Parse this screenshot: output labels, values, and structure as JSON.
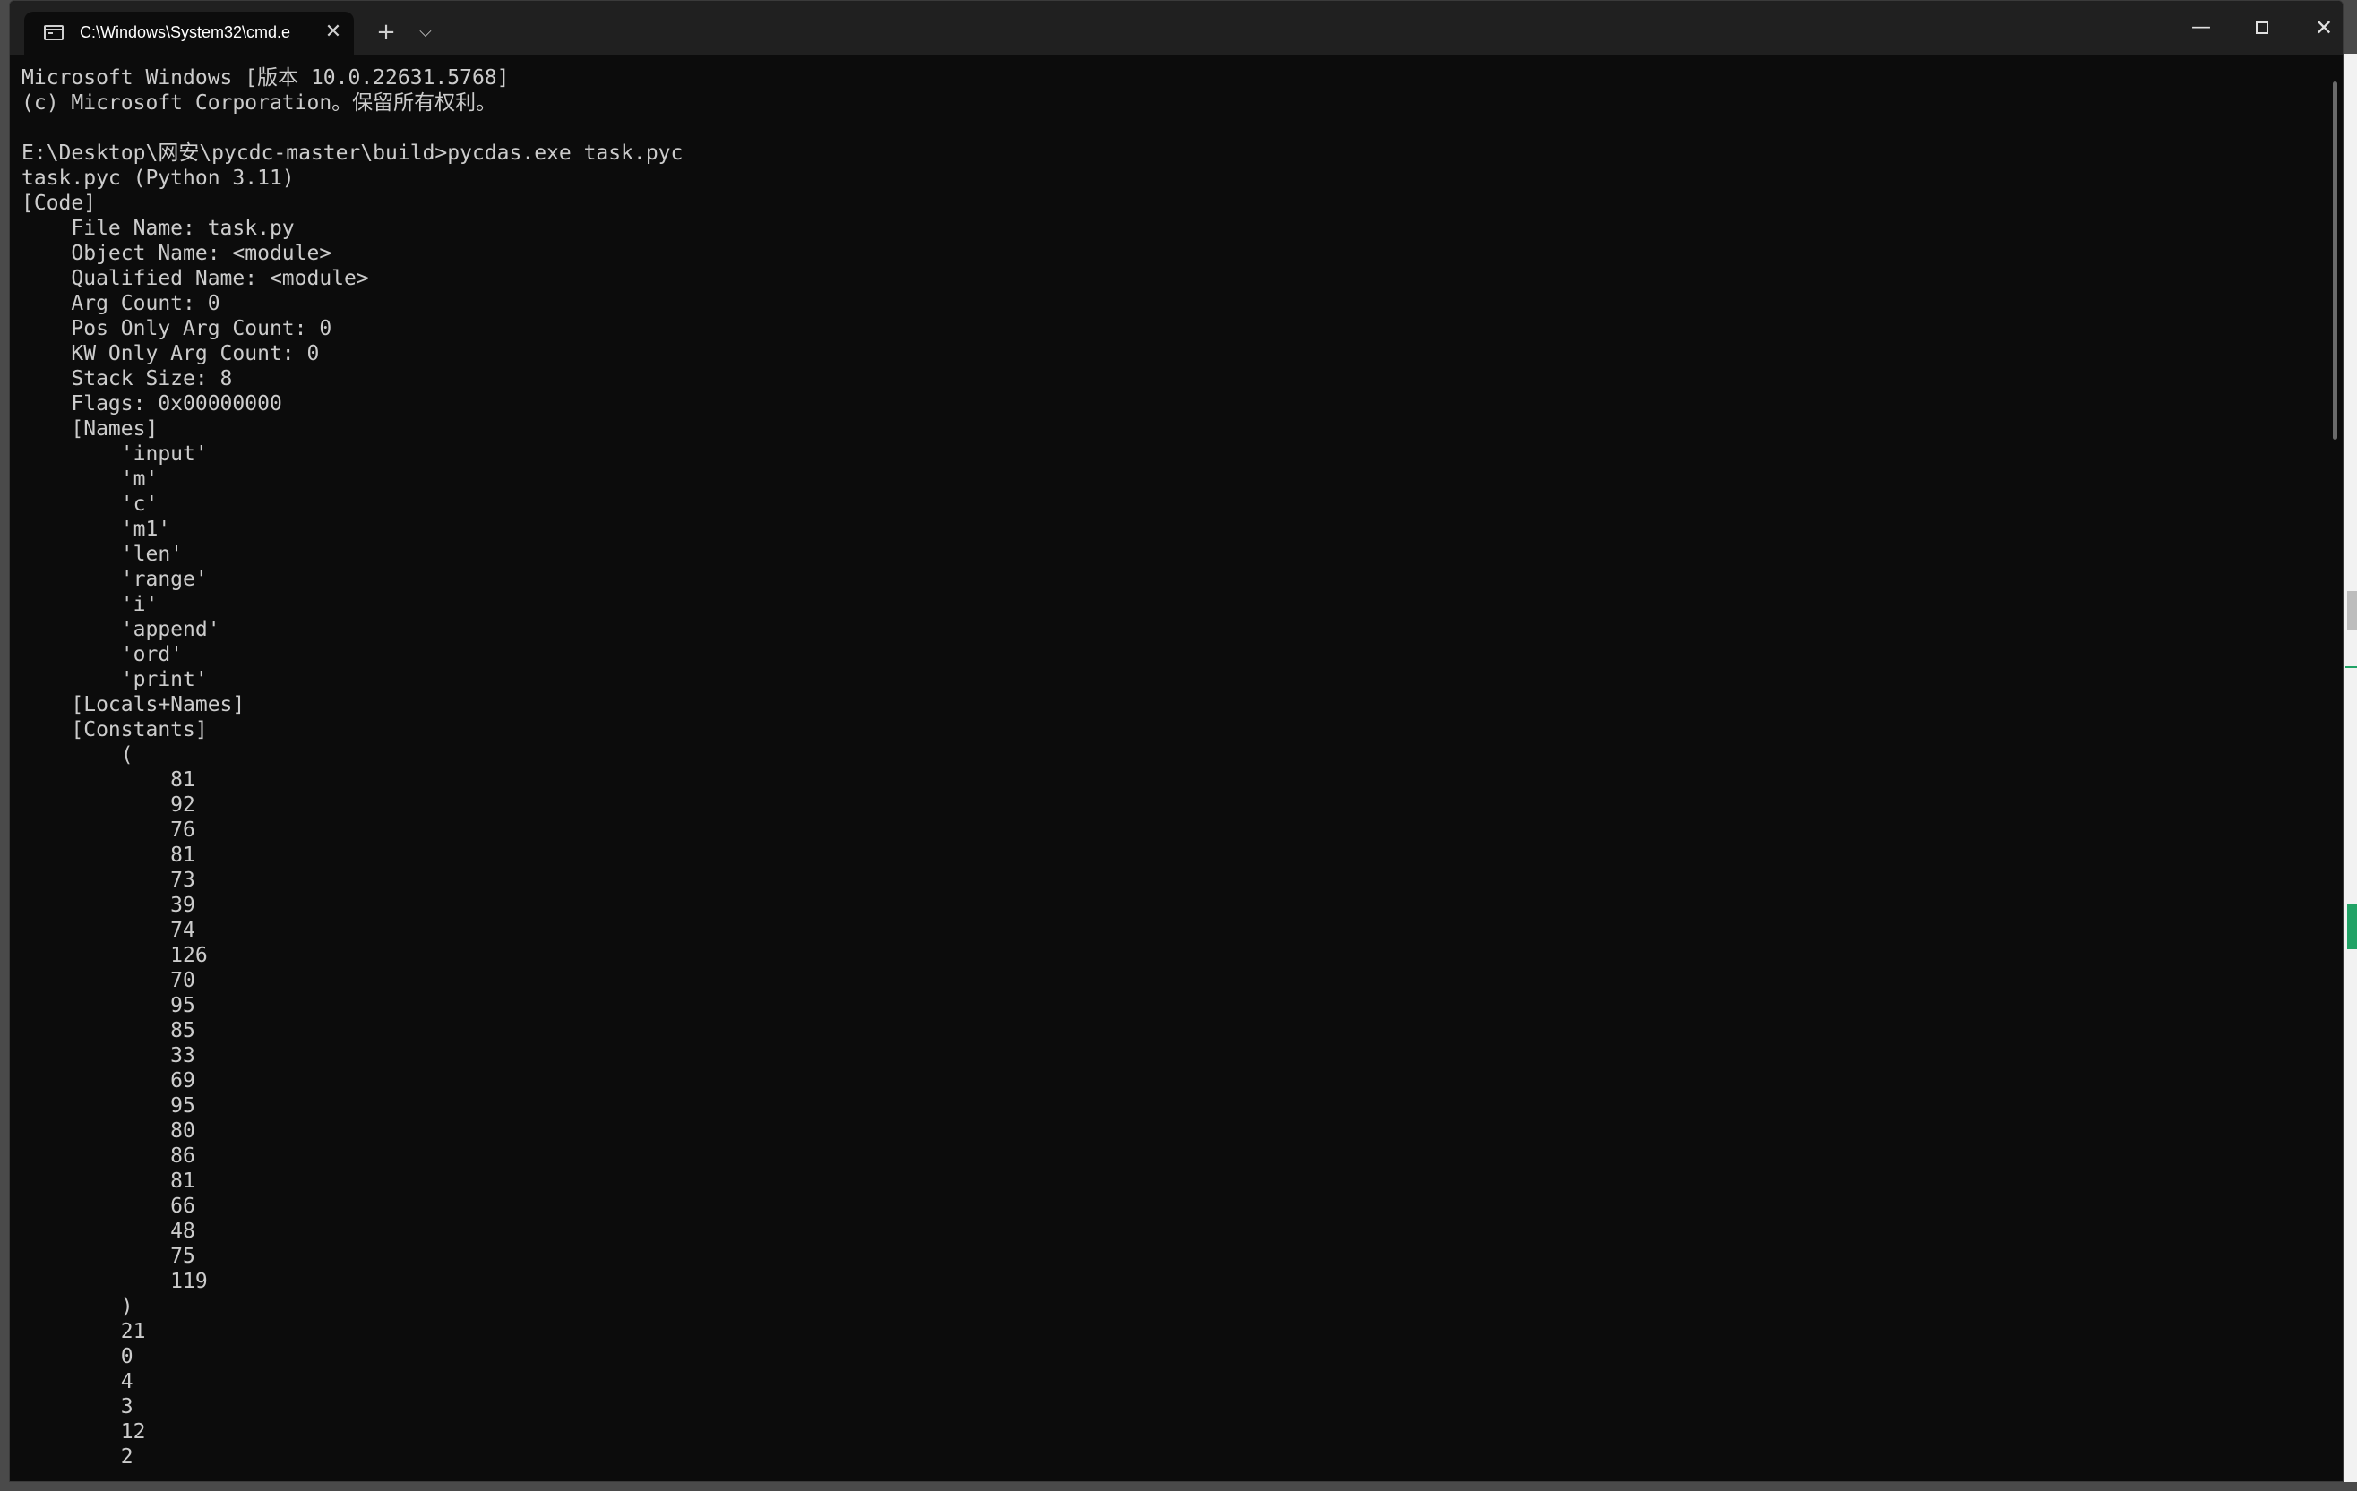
{
  "tab": {
    "title": "C:\\Windows\\System32\\cmd.e",
    "close_glyph": "✕"
  },
  "toolbar": {
    "new_tab_glyph": "+",
    "dropdown_glyph": "⌵"
  },
  "window_controls": {
    "minimize_glyph": "—",
    "close_glyph": "✕"
  },
  "icons": {
    "tab": "terminal-icon",
    "close": "close-icon",
    "new_tab": "plus-icon",
    "dropdown": "chevron-down-icon",
    "minimize": "minimize-icon",
    "maximize": "maximize-icon",
    "window_close": "close-icon"
  },
  "colors": {
    "console_bg": "#0c0c0c",
    "titlebar_bg": "#202020",
    "text": "#cccccc"
  },
  "console": {
    "lines": [
      "Microsoft Windows [版本 10.0.22631.5768]",
      "(c) Microsoft Corporation。保留所有权利。",
      "",
      "E:\\Desktop\\网安\\pycdc-master\\build>pycdas.exe task.pyc",
      "task.pyc (Python 3.11)",
      "[Code]",
      "    File Name: task.py",
      "    Object Name: <module>",
      "    Qualified Name: <module>",
      "    Arg Count: 0",
      "    Pos Only Arg Count: 0",
      "    KW Only Arg Count: 0",
      "    Stack Size: 8",
      "    Flags: 0x00000000",
      "    [Names]",
      "        'input'",
      "        'm'",
      "        'c'",
      "        'm1'",
      "        'len'",
      "        'range'",
      "        'i'",
      "        'append'",
      "        'ord'",
      "        'print'",
      "    [Locals+Names]",
      "    [Constants]",
      "        (",
      "            81",
      "            92",
      "            76",
      "            81",
      "            73",
      "            39",
      "            74",
      "            126",
      "            70",
      "            95",
      "            85",
      "            33",
      "            69",
      "            95",
      "            80",
      "            86",
      "            81",
      "            66",
      "            48",
      "            75",
      "            119",
      "        )",
      "        21",
      "        0",
      "        4",
      "        3",
      "        12",
      "        2"
    ]
  }
}
